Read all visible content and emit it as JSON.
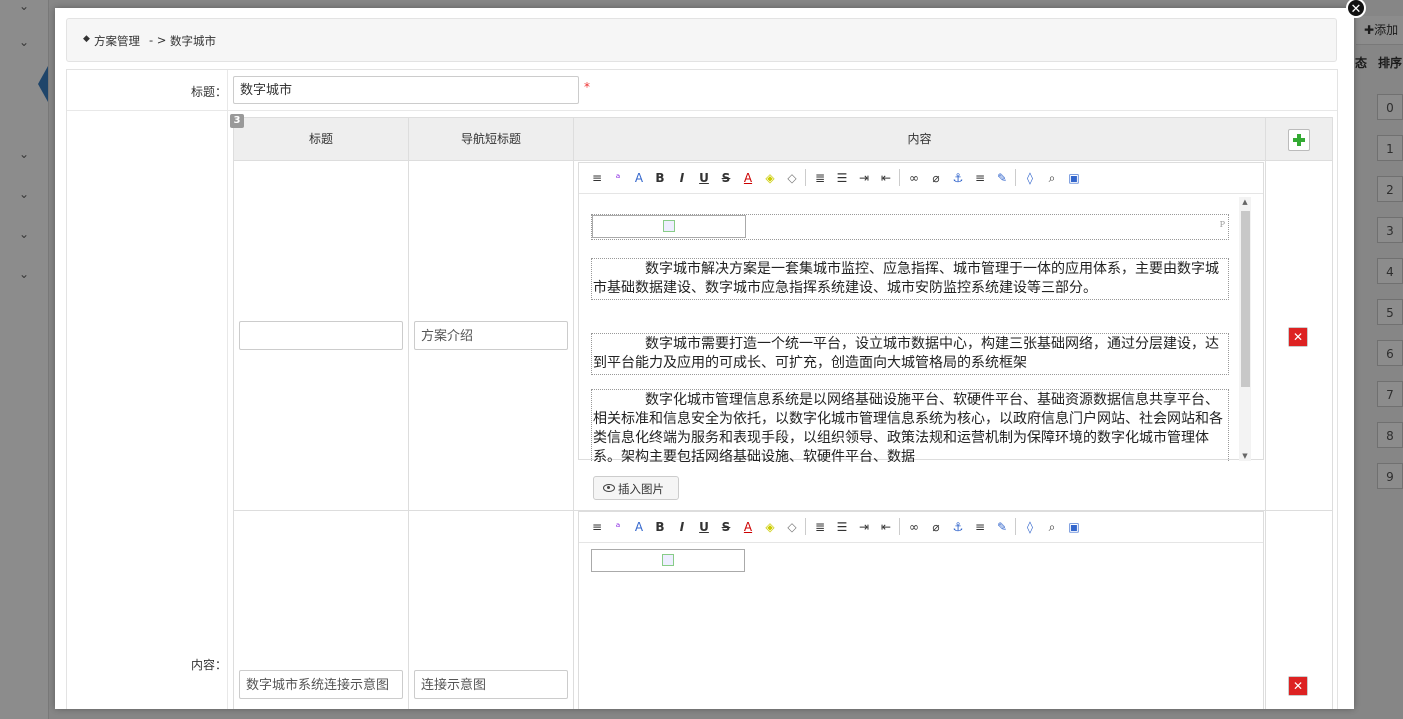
{
  "background": {
    "add_label": "添加",
    "col_state": "态",
    "col_sort": "排序",
    "sort_values": [
      "0",
      "1",
      "2",
      "3",
      "4",
      "5",
      "6",
      "7",
      "8",
      "9"
    ]
  },
  "modal": {
    "close_icon": "close-icon",
    "breadcrumb": {
      "root": "方案管理",
      "sep": "- >",
      "current": "数字城市"
    },
    "form": {
      "title_label": "标题：",
      "title_value": "数字城市",
      "required_mark": "*",
      "content_label": "内容：",
      "grid": {
        "count": "3",
        "headers": {
          "title": "标题",
          "nav_title": "导航短标题",
          "content": "内容"
        },
        "rows": [
          {
            "title": "",
            "nav_title": "方案介绍",
            "paragraphs": [
              "数字城市解决方案是一套集城市监控、应急指挥、城市管理于一体的应用体系，主要由数字城市基础数据建设、数字城市应急指挥系统建设、城市安防监控系统建设等三部分。",
              "数字城市需要打造一个统一平台，设立城市数据中心，构建三张基础网络，通过分层建设，达到平台能力及应用的可成长、可扩充，创造面向大城管格局的系统框架",
              "数字化城市管理信息系统是以网络基础设施平台、软硬件平台、基础资源数据信息共享平台、相关标准和信息安全为依托，以数字化城市管理信息系统为核心，以政府信息门户网站、社会网站和各类信息化终端为服务和表现手段，以组织领导、政策法规和运营机制为保障环境的数字化城市管理体系。架构主要包括网络基础设施、软硬件平台、数据"
            ],
            "insert_image": "插入图片"
          },
          {
            "title": "数字城市系统连接示意图",
            "nav_title": "连接示意图"
          }
        ]
      }
    }
  }
}
